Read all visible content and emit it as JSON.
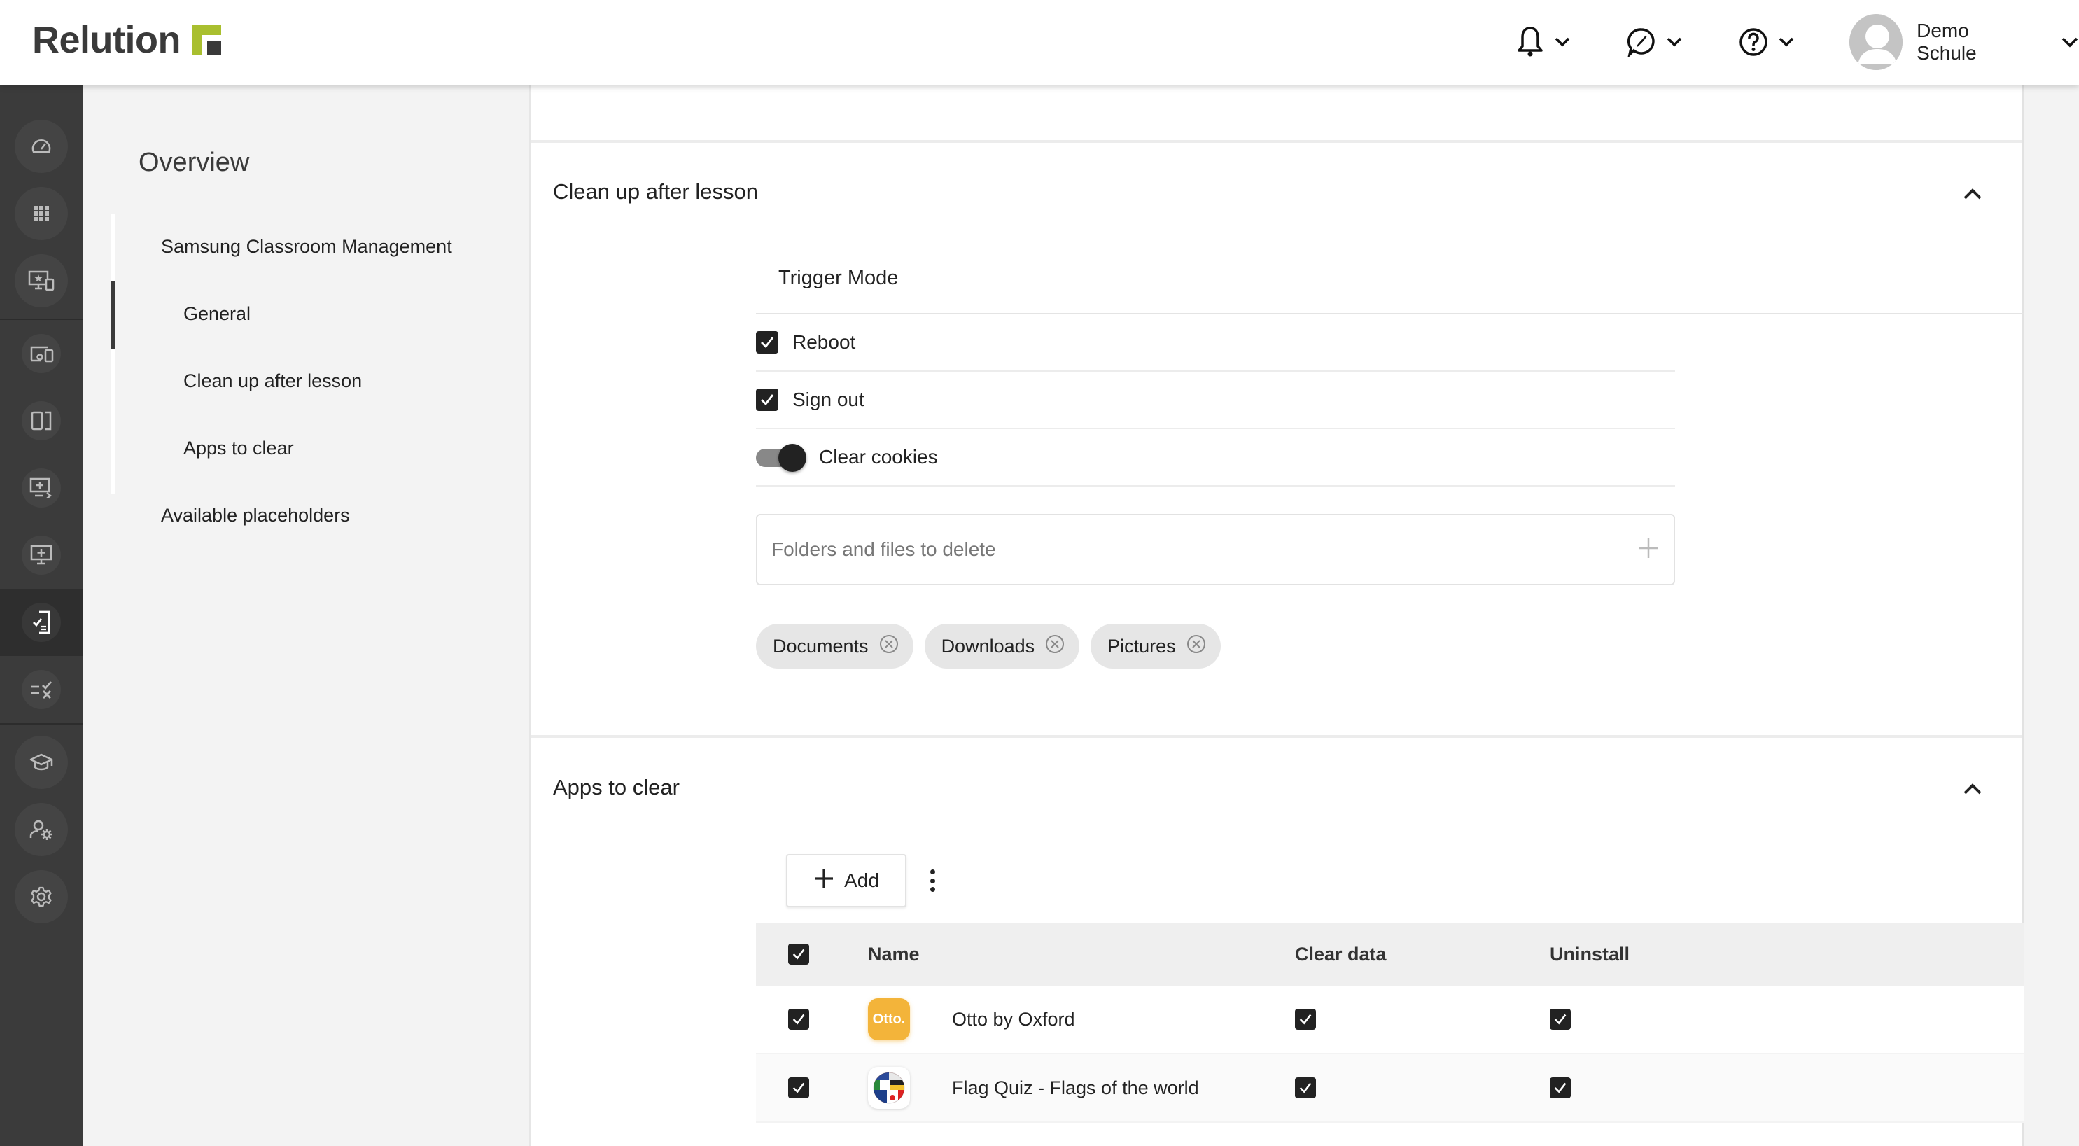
{
  "header": {
    "logo_text": "Relution",
    "notifications_label": "Notifications",
    "compass_label": "Explore",
    "help_label": "Help",
    "user_name": "Demo Schule",
    "brand_color": "#a9bf2f"
  },
  "nav": {
    "items": [
      {
        "icon": "dashboard-gauge-icon"
      },
      {
        "icon": "apps-grid-icon"
      },
      {
        "icon": "devices-star-icon"
      },
      {
        "icon": "device-group-icon"
      },
      {
        "icon": "tablet-icon"
      },
      {
        "icon": "monitor-add-arrow-icon"
      },
      {
        "icon": "monitor-add-icon"
      },
      {
        "icon": "policy-checklist-icon",
        "active": true
      },
      {
        "icon": "compliance-list-icon"
      },
      {
        "icon": "education-cap-icon"
      },
      {
        "icon": "user-settings-icon"
      },
      {
        "icon": "settings-gear-icon"
      }
    ]
  },
  "overview": {
    "title": "Overview",
    "items": [
      {
        "label": "Samsung Classroom Management",
        "level": 1
      },
      {
        "label": "General",
        "level": 2,
        "active": true
      },
      {
        "label": "Clean up after lesson",
        "level": 2
      },
      {
        "label": "Apps to clear",
        "level": 2
      },
      {
        "label": "Available placeholders",
        "level": 1
      }
    ]
  },
  "cleanup": {
    "title": "Clean up after lesson",
    "trigger_mode_label": "Trigger Mode",
    "options": [
      {
        "label": "Reboot",
        "type": "checkbox",
        "checked": true
      },
      {
        "label": "Sign out",
        "type": "checkbox",
        "checked": true
      },
      {
        "label": "Clear cookies",
        "type": "toggle",
        "on": true
      }
    ],
    "files_placeholder": "Folders and files to delete",
    "files_value": "",
    "chips": [
      "Documents",
      "Downloads",
      "Pictures"
    ]
  },
  "apps": {
    "title": "Apps to clear",
    "add_label": "Add",
    "columns": [
      "Name",
      "Clear data",
      "Uninstall"
    ],
    "select_all": true,
    "rows": [
      {
        "name": "Otto by Oxford",
        "icon": "otto-app-icon",
        "icon_text": "Otto.",
        "selected": true,
        "clear_data": true,
        "uninstall": true
      },
      {
        "name": "Flag Quiz - Flags of the world",
        "icon": "flag-quiz-app-icon",
        "selected": true,
        "clear_data": true,
        "uninstall": true
      }
    ]
  }
}
